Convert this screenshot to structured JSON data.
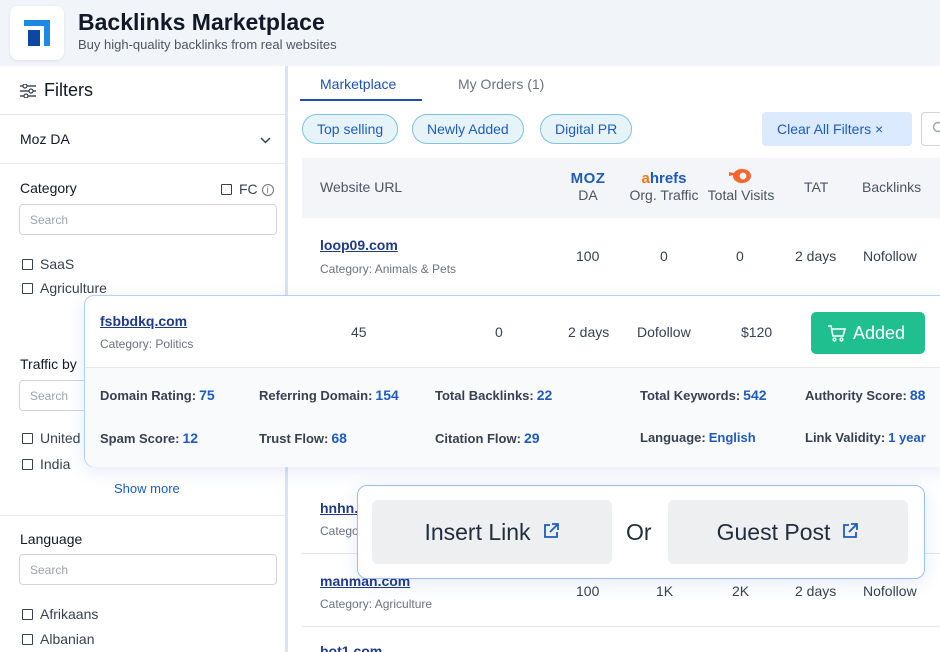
{
  "app": {
    "title": "Backlinks Marketplace",
    "subtitle": "Buy high-quality backlinks from real websites"
  },
  "sidebar": {
    "heading": "Filters",
    "moz_da": "Moz DA",
    "category": {
      "title": "Category",
      "fc_label": "FC",
      "search_placeholder": "Search",
      "items": [
        "SaaS",
        "Agriculture"
      ]
    },
    "traffic": {
      "title": "Traffic by",
      "search_placeholder": "Search",
      "items": [
        "United",
        "India"
      ],
      "show_more": "Show more"
    },
    "language": {
      "title": "Language",
      "search_placeholder": "Search",
      "items": [
        "Afrikaans",
        "Albanian"
      ]
    }
  },
  "tabs": {
    "marketplace": "Marketplace",
    "my_orders": "My Orders (1)"
  },
  "chips": [
    "Top selling",
    "Newly Added",
    "Digital PR"
  ],
  "clear_filters": "Clear All Filters  ×",
  "table": {
    "headers": {
      "website_url": "Website URL",
      "moz_logo": "MOZ",
      "da": "DA",
      "ahrefs_logo_a": "a",
      "ahrefs_logo_rest": "hrefs",
      "org_traffic": "Org. Traffic",
      "total_visits": "Total Visits",
      "tat": "TAT",
      "backlinks": "Backlinks"
    },
    "rows": [
      {
        "url": "loop09.com",
        "category": "Category: Animals & Pets",
        "da": "100",
        "traffic": "0",
        "visits": "0",
        "tat": "2 days",
        "backlinks": "Nofollow"
      },
      {
        "url": "hnhn.",
        "category": "Catego"
      },
      {
        "url": "manman.com",
        "category": "Category: Agriculture",
        "da": "100",
        "traffic": "1K",
        "visits": "2K",
        "tat": "2 days",
        "backlinks": "Nofollow"
      },
      {
        "url": "bot1.com"
      }
    ]
  },
  "expanded": {
    "url": "fsbbdkq.com",
    "category": "Category: Politics",
    "da": "45",
    "traffic": "0",
    "tat": "2 days",
    "backlinks": "Dofollow",
    "price": "$120",
    "added_label": "Added",
    "metrics": {
      "domain_rating": {
        "label": "Domain Rating:",
        "value": "75"
      },
      "referring_domain": {
        "label": "Referring Domain:",
        "value": "154"
      },
      "total_backlinks": {
        "label": "Total Backlinks:",
        "value": "22"
      },
      "total_keywords": {
        "label": "Total Keywords:",
        "value": "542"
      },
      "authority_score": {
        "label": "Authority Score:",
        "value": "88"
      },
      "spam_score": {
        "label": "Spam Score:",
        "value": "12"
      },
      "trust_flow": {
        "label": "Trust Flow:",
        "value": "68"
      },
      "citation_flow": {
        "label": "Citation Flow:",
        "value": "29"
      },
      "language": {
        "label": "Language:",
        "value": "English"
      },
      "link_validity": {
        "label": "Link Validity:",
        "value": "1 year"
      }
    }
  },
  "choice": {
    "insert_link": "Insert Link",
    "or": "Or",
    "guest_post": "Guest Post"
  },
  "colors": {
    "accent": "#1e5bbd",
    "added_green": "#1fbf8f",
    "chip_bg": "#e6f4fa"
  }
}
